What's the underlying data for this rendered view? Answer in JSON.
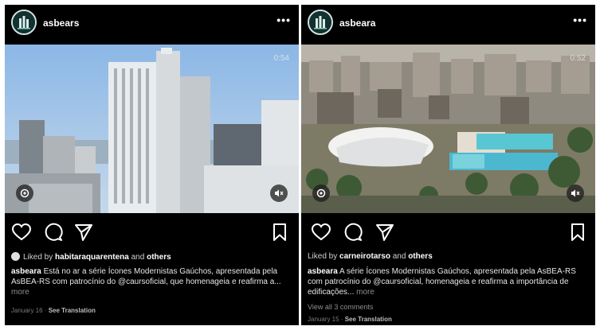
{
  "posts": [
    {
      "username": "asbears",
      "more_icon": "more-horizontal-icon",
      "duration": "0:54",
      "liked_prefix": "Liked by ",
      "liked_user": "habitaraquarentena",
      "liked_conj": " and ",
      "liked_others": "others",
      "caption_user": "asbeara",
      "caption_text": " Está no ar a série Ícones Modernistas Gaúchos, apresentada pela AsBEA-RS com patrocínio do @caursoficial, que homenageia e reafirma a...",
      "more_label": "more",
      "date": "January 16",
      "see_translation": "See Translation"
    },
    {
      "username": "asbeara",
      "more_icon": "more-horizontal-icon",
      "duration": "0:52",
      "liked_prefix": "Liked by ",
      "liked_user": "carneirotarso",
      "liked_conj": " and ",
      "liked_others": "others",
      "caption_user": "asbeara",
      "caption_text": " A série Ícones Modernistas Gaúchos, apresentada pela AsBEA-RS com patrocínio do @caursoficial, homenageia e reafirma a importância de edificações...",
      "more_label": "more",
      "view_comments": "View all 3 comments",
      "date": "January 15",
      "see_translation": "See Translation"
    }
  ],
  "colors": {
    "background": "#000000",
    "text": "#ffffff",
    "muted": "#8e8e8e",
    "page": "#ffffff"
  }
}
